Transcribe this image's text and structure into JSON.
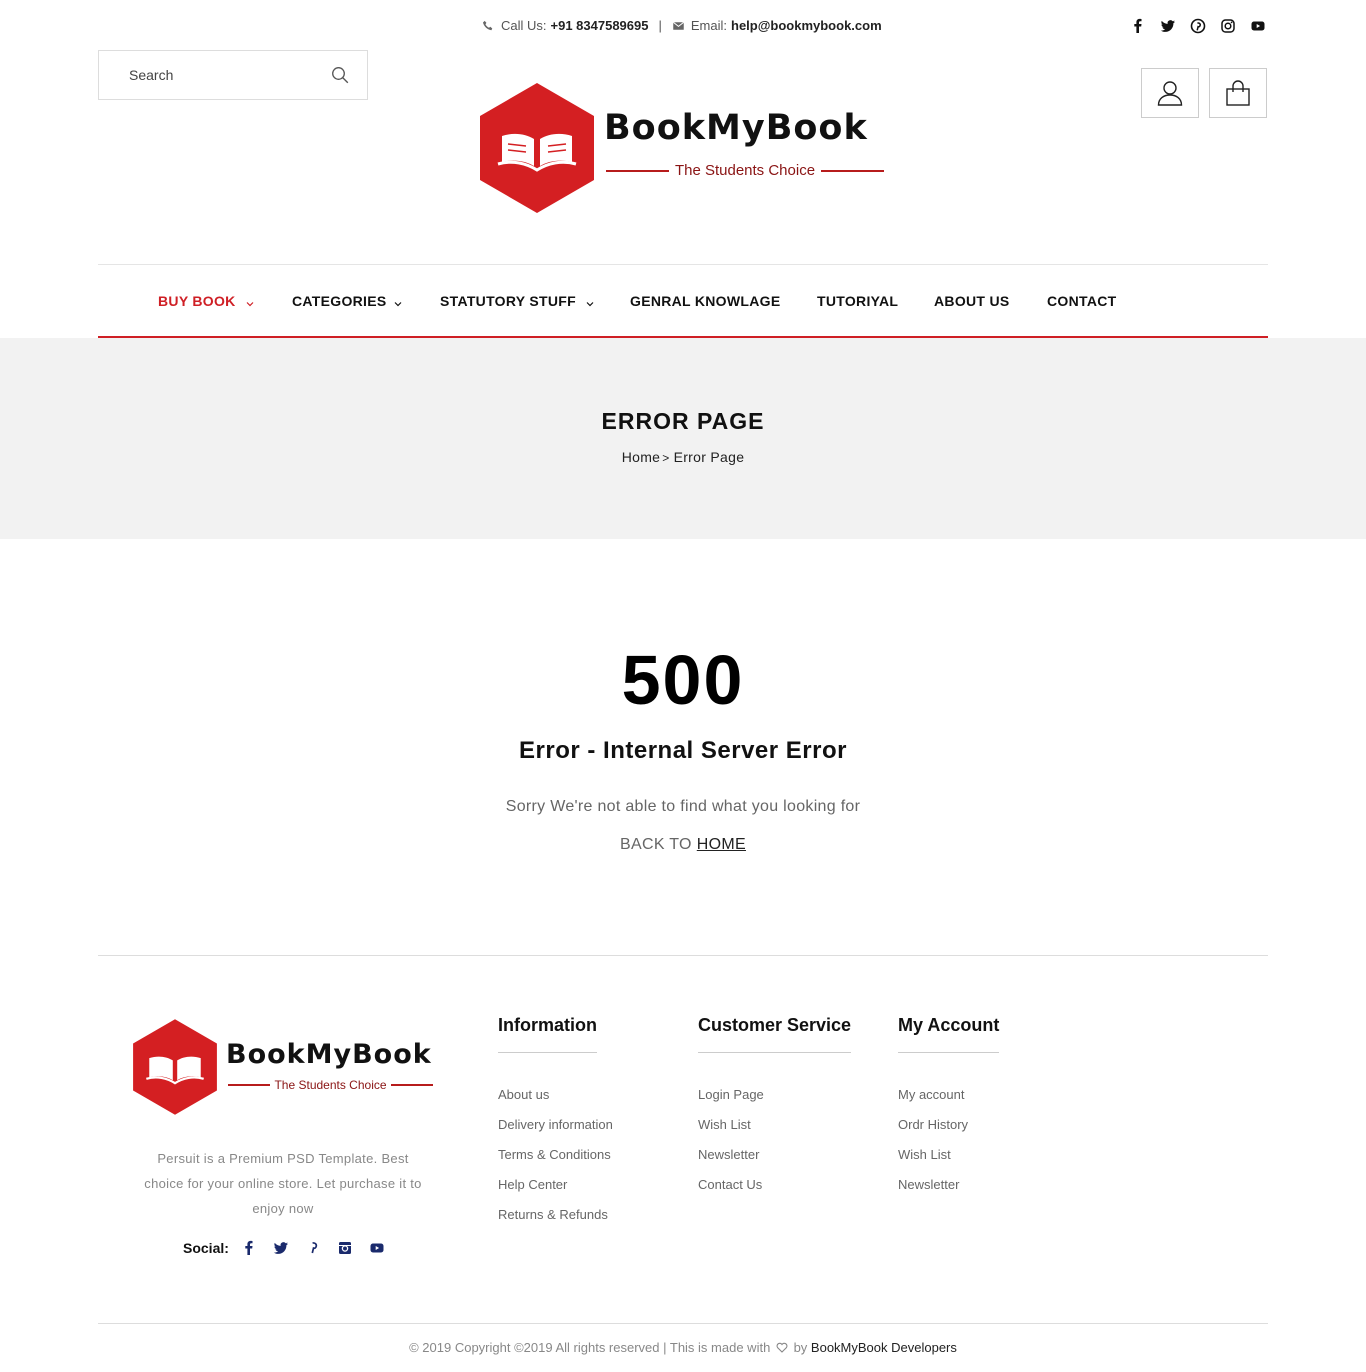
{
  "topbar": {
    "call_label": "Call Us:",
    "phone": "+91 8347589695",
    "separator": "|",
    "email_label": "Email:",
    "email": "help@bookmybook.com",
    "social_icons": [
      "facebook-icon",
      "twitter-icon",
      "pinterest-icon",
      "instagram-icon",
      "youtube-icon"
    ]
  },
  "search": {
    "placeholder": "Search"
  },
  "brand": {
    "name": "BookMyBook",
    "tagline": "The Students Choice",
    "accent": "#cf1f25"
  },
  "nav": {
    "items": [
      {
        "label": "BUY BOOK",
        "dropdown": true,
        "active": true
      },
      {
        "label": "CATEGORIES",
        "dropdown": true
      },
      {
        "label": "STATUTORY STUFF",
        "dropdown": true
      },
      {
        "label": "GENRAL KNOWLAGE"
      },
      {
        "label": "TUTORIYAL"
      },
      {
        "label": "ABOUT US"
      },
      {
        "label": "CONTACT"
      }
    ]
  },
  "page_header": {
    "title": "ERROR PAGE",
    "breadcrumb_home": "Home",
    "breadcrumb_sep": ">",
    "breadcrumb_current": "Error Page"
  },
  "error": {
    "code": "500",
    "title": "Error - Internal Server Error",
    "message": "Sorry We're not able to find what you looking for",
    "back_prefix": "BACK TO",
    "back_link": "HOME"
  },
  "footer": {
    "description": "Persuit is a Premium PSD Template. Best choice for your online store. Let purchase it to enjoy now",
    "social_label": "Social:",
    "columns": [
      {
        "title": "Information",
        "links": [
          "About us",
          "Delivery information",
          "Terms & Conditions",
          "Help Center",
          "Returns & Refunds"
        ]
      },
      {
        "title": "Customer Service",
        "links": [
          "Login Page",
          "Wish List",
          "Newsletter",
          "Contact Us"
        ]
      },
      {
        "title": "My Account",
        "links": [
          "My account",
          "Ordr History",
          "Wish List",
          "Newsletter"
        ]
      }
    ],
    "copyright_prefix": "© 2019 Copyright ©2019 All rights reserved | This is made with",
    "copyright_by": "by",
    "copyright_author": "BookMyBook Developers"
  }
}
